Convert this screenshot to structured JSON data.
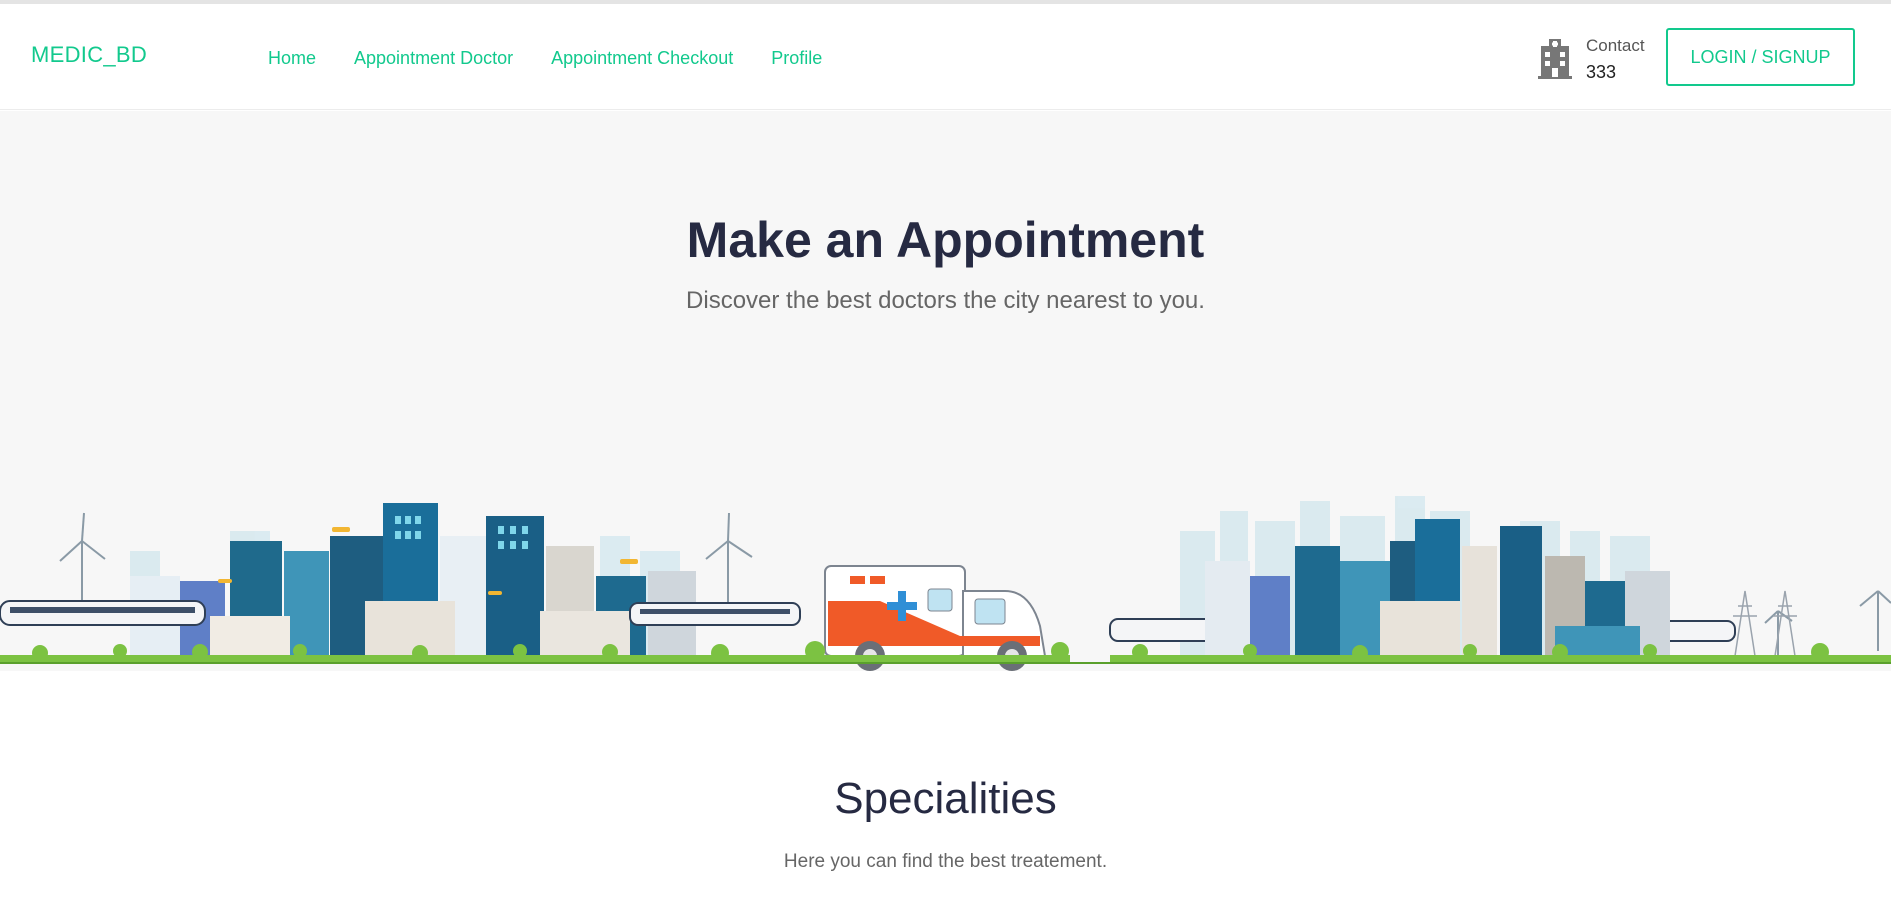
{
  "brand": {
    "logo": "MEDIC_BD"
  },
  "nav": {
    "items": [
      {
        "label": "Home"
      },
      {
        "label": "Appointment Doctor"
      },
      {
        "label": "Appointment Checkout"
      },
      {
        "label": "Profile"
      }
    ]
  },
  "contact": {
    "label": "Contact",
    "number": "333",
    "icon": "hospital-building-icon"
  },
  "auth": {
    "button_label": "LOGIN / SIGNUP"
  },
  "hero": {
    "title": "Make an Appointment",
    "subtitle": "Discover the best doctors the city nearest to you."
  },
  "specialities": {
    "title": "Specialities",
    "subtitle": "Here you can find the best treatement."
  },
  "colors": {
    "accent": "#12c98d",
    "heading": "#262a42",
    "hero_bg": "#f7f7f7"
  }
}
